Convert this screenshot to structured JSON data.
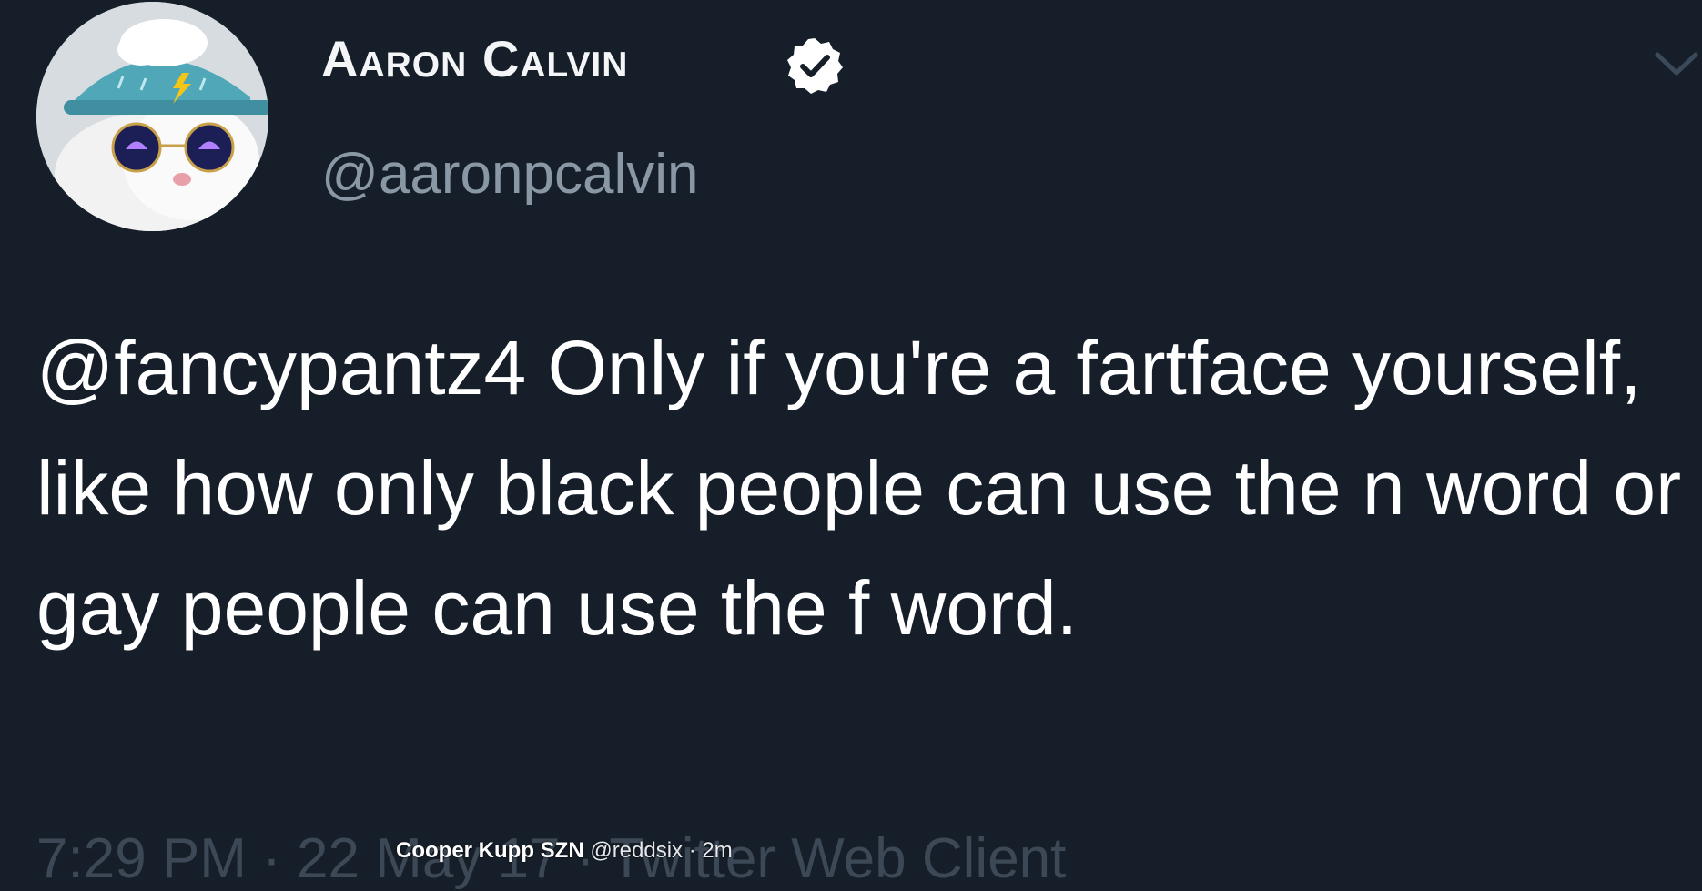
{
  "profile": {
    "display_name": "Aaron Calvin",
    "handle": "@aaronpcalvin",
    "verified": true,
    "avatar_icon": "cat-with-rain-cloud-hat-and-umbrella-sunglasses"
  },
  "tweet": {
    "text": "@fancypantz4 Only if you're a fartface yourself, like how only black people can use the n word or gay people can use the f word.",
    "timestamp_partial": "7:29 PM · 22 May 17 · Twitter Web Client"
  },
  "overlay": {
    "name": "Cooper Kupp SZN",
    "handle": "@reddsix",
    "time": "· 2m"
  },
  "colors": {
    "background": "#161f29",
    "secondary_text": "#8a98a6",
    "primary_text": "#ffffff"
  }
}
